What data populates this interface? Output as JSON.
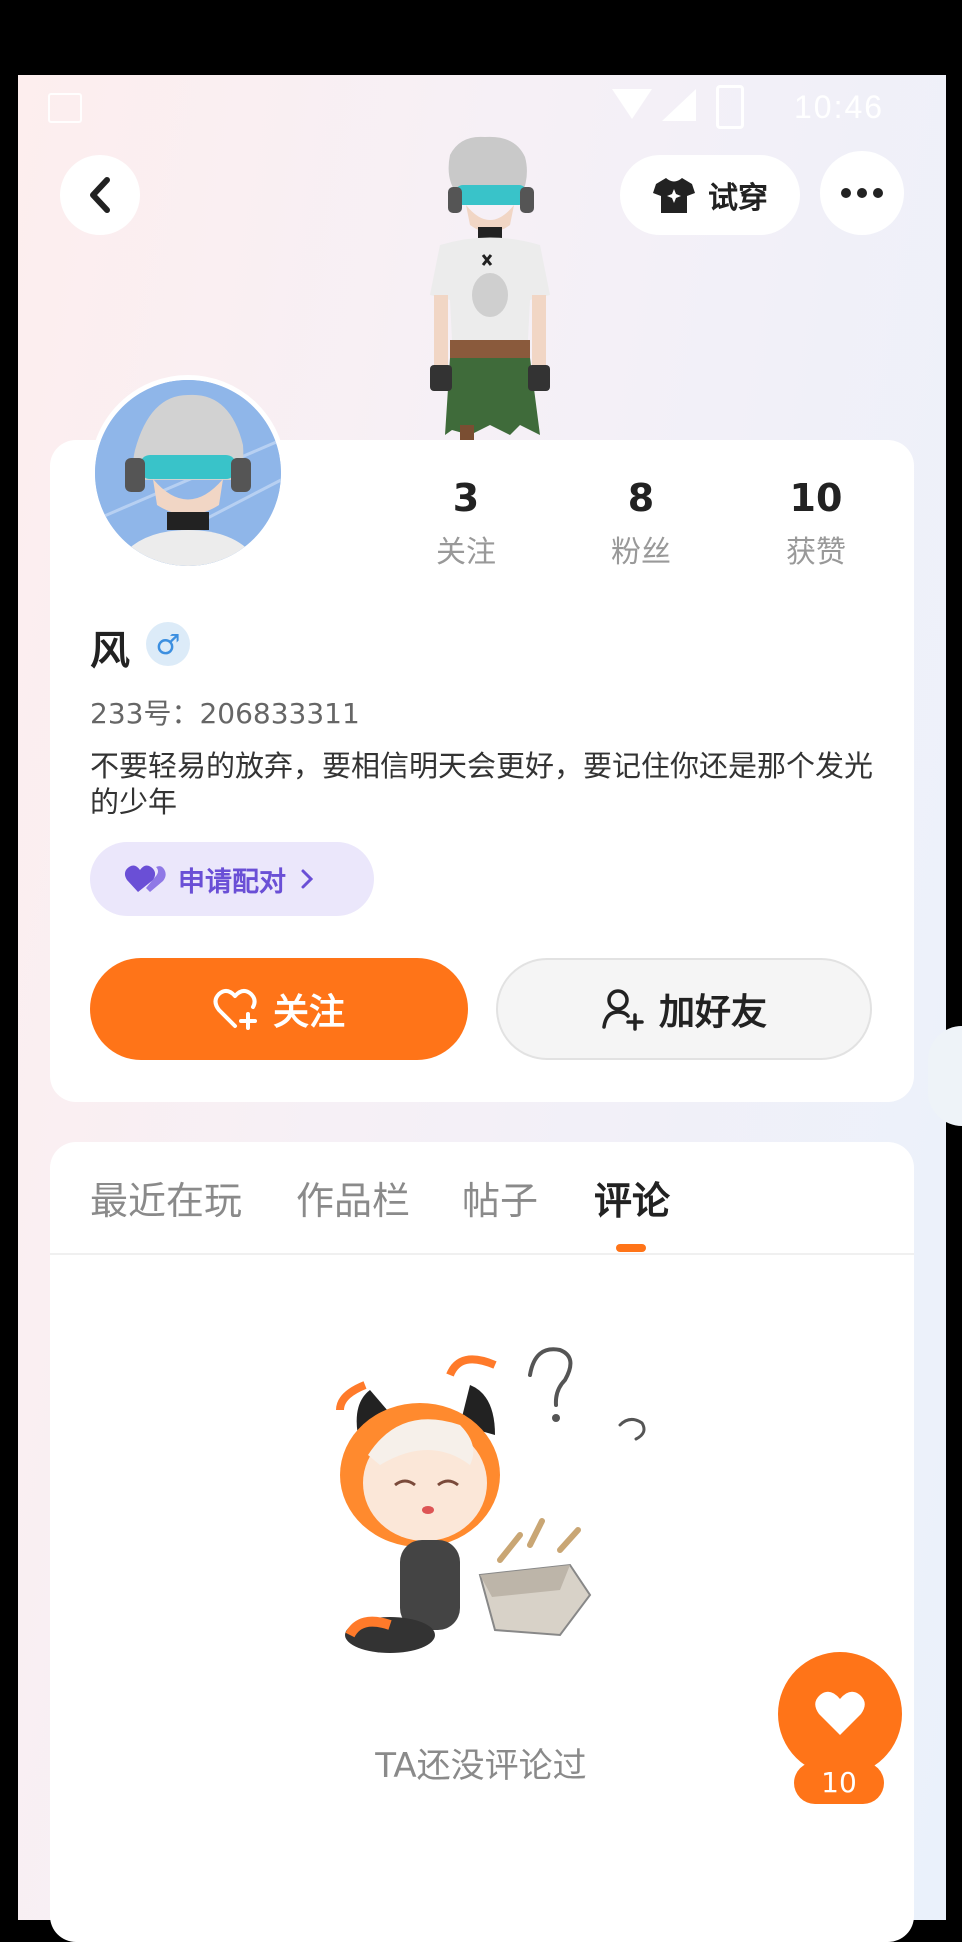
{
  "status_bar": {
    "time": "10:46"
  },
  "header": {
    "try_on_label": "试穿"
  },
  "profile": {
    "stats": [
      {
        "value": "3",
        "label": "关注"
      },
      {
        "value": "8",
        "label": "粉丝"
      },
      {
        "value": "10",
        "label": "获赞"
      }
    ],
    "name": "风",
    "gender_symbol": "♂",
    "uid": "233号：206833311",
    "bio": "不要轻易的放弃，要相信明天会更好，要记住你还是那个发光的少年",
    "pair_label": "申请配对",
    "follow_label": "关注",
    "add_friend_label": "加好友"
  },
  "tabs": [
    {
      "label": "最近在玩",
      "active": false
    },
    {
      "label": "作品栏",
      "active": false
    },
    {
      "label": "帖子",
      "active": false
    },
    {
      "label": "评论",
      "active": true
    }
  ],
  "empty_state": {
    "text": "TA还没评论过"
  },
  "like_fab": {
    "count": "10"
  },
  "colors": {
    "accent": "#ff7418",
    "pair_bg": "#ebe7fb",
    "pair_text": "#6a4fd6"
  }
}
